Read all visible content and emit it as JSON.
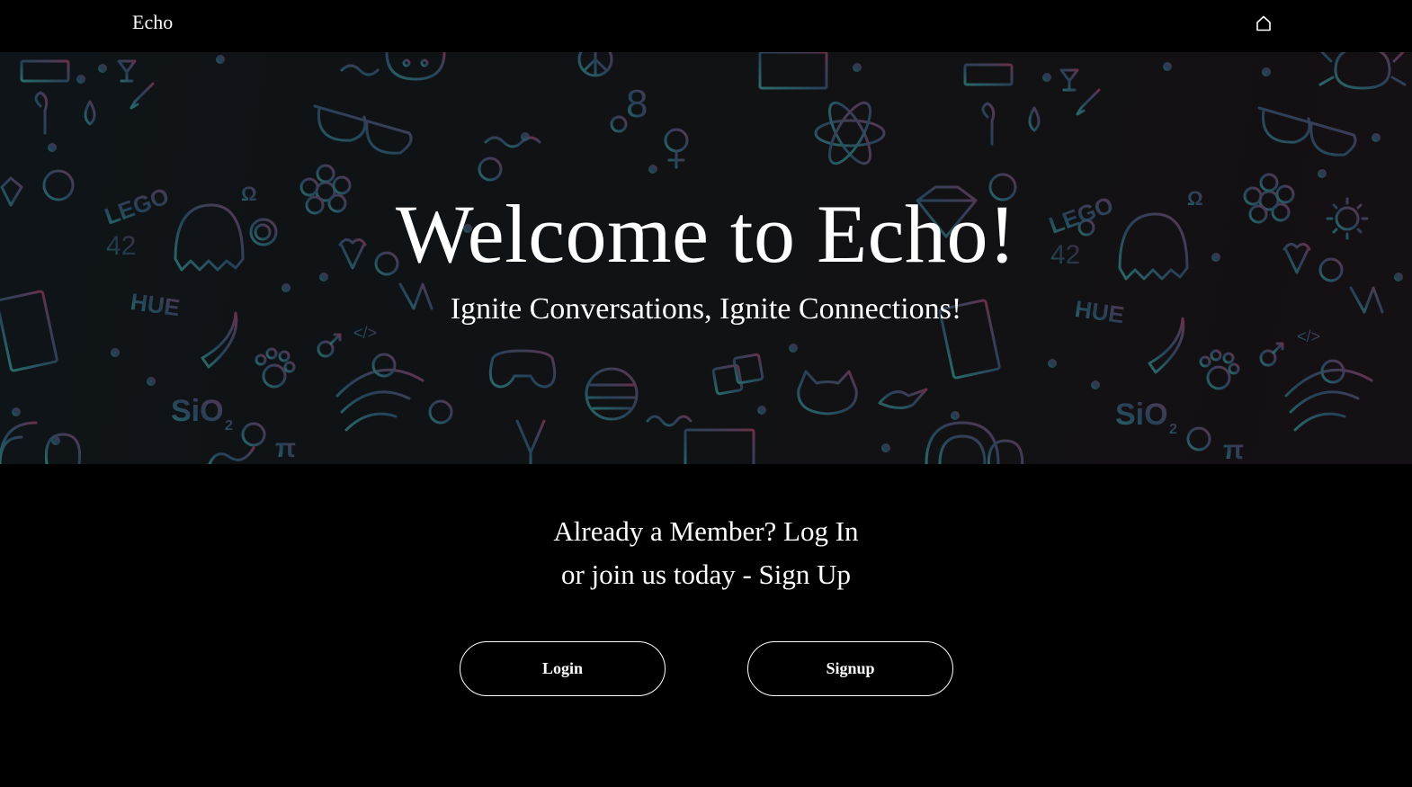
{
  "navbar": {
    "brand": "Echo",
    "home_icon": "home-icon"
  },
  "hero": {
    "title": "Welcome to Echo!",
    "subtitle": "Ignite Conversations, Ignite Connections!",
    "doodle_texts": [
      "LEGO",
      "HUE",
      "42",
      "SiO",
      "2",
      "π",
      "Ω",
      "♂",
      "♀",
      "</>",
      "8"
    ]
  },
  "cta": {
    "line1": "Already a Member? Log In",
    "line2": "or join us today - Sign Up"
  },
  "buttons": {
    "login": "Login",
    "signup": "Signup"
  },
  "colors": {
    "background": "#000000",
    "text": "#ffffff",
    "doodle_teal": "#2f6f7a",
    "doodle_blue": "#2b4a63",
    "doodle_purple": "#5a4a68",
    "doodle_pink": "#6e3a52"
  }
}
